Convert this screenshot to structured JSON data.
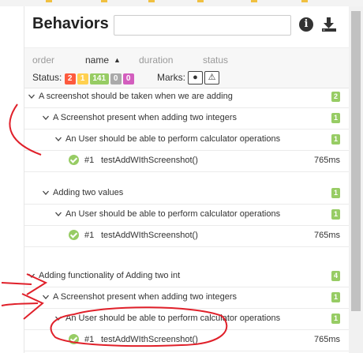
{
  "header": {
    "title": "Behaviors",
    "search": {
      "value": "",
      "placeholder": ""
    },
    "info_icon": "info-icon",
    "download_icon": "download-icon"
  },
  "sort": {
    "columns": [
      "order",
      "name",
      "duration",
      "status"
    ],
    "active": "name"
  },
  "status": {
    "label": "Status:",
    "counts": [
      {
        "value": "2",
        "color": "#fd5a3e"
      },
      {
        "value": "1",
        "color": "#ffd050"
      },
      {
        "value": "141",
        "color": "#97cc64"
      },
      {
        "value": "0",
        "color": "#aaaaaa"
      },
      {
        "value": "0",
        "color": "#d35ebe"
      }
    ]
  },
  "marks": {
    "label": "Marks:",
    "icons": [
      "bomb-icon",
      "warning-icon"
    ]
  },
  "tree": {
    "groups": [
      {
        "label": "A screenshot should be taken when we are adding",
        "count": "2",
        "children": [
          {
            "label": "A Screenshot present when adding two integers",
            "count": "1",
            "children": [
              {
                "label": "An User should be able to perform calculator operations",
                "count": "1",
                "tests": [
                  {
                    "num": "#1",
                    "name": "testAddWIthScreenshot()",
                    "duration": "765ms"
                  }
                ]
              }
            ]
          },
          {
            "label": "Adding two values",
            "count": "1",
            "children": [
              {
                "label": "An User should be able to perform calculator operations",
                "count": "1",
                "tests": [
                  {
                    "num": "#1",
                    "name": "testAddWIthScreenshot()",
                    "duration": "765ms"
                  }
                ]
              }
            ]
          }
        ]
      },
      {
        "label": "Adding functionality of Adding two int",
        "count": "4",
        "children": [
          {
            "label": "A Screenshot present when adding two integers",
            "count": "1",
            "children": [
              {
                "label": "An User should be able to perform calculator operations",
                "count": "1",
                "tests": [
                  {
                    "num": "#1",
                    "name": "testAddWIthScreenshot()",
                    "duration": "765ms"
                  }
                ]
              }
            ]
          }
        ]
      }
    ]
  },
  "colors": {
    "passed": "#97cc64",
    "annotation": "#e0202a"
  }
}
